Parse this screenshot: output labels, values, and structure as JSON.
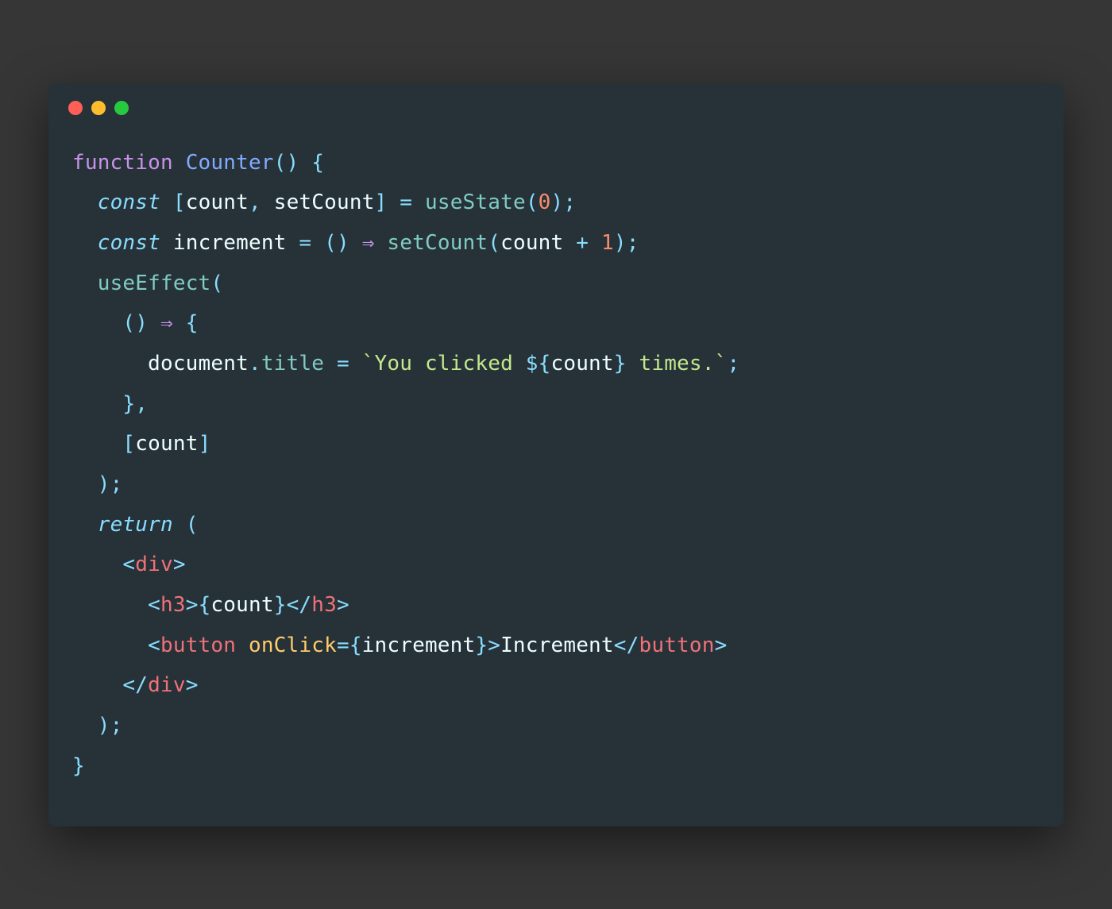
{
  "window": {
    "traffic": {
      "red": "#ff5f56",
      "yellow": "#ffbd2e",
      "green": "#27c93f"
    }
  },
  "code": {
    "t": {
      "function": "function",
      "Counter": "Counter",
      "lparen": "(",
      "rparen": ")",
      "lbrace": "{",
      "rbrace": "}",
      "const": "const",
      "lbracket": "[",
      "rbracket": "]",
      "count": "count",
      "comma": ",",
      "setCount": "setCount",
      "eq": "=",
      "useState": "useState",
      "zero": "0",
      "semi": ";",
      "increment": "increment",
      "arrow": "⇒",
      "plus": "+",
      "one": "1",
      "useEffect": "useEffect",
      "document": "document",
      "dot": ".",
      "title": "title",
      "backtick": "`",
      "str1": "You clicked ",
      "dollar": "$",
      "str2": " times.",
      "return": "return",
      "lt": "<",
      "gt": ">",
      "slash": "/",
      "div": "div",
      "h3": "h3",
      "button": "button",
      "onClick": "onClick",
      "Increment": "Increment",
      "sp": " "
    }
  }
}
